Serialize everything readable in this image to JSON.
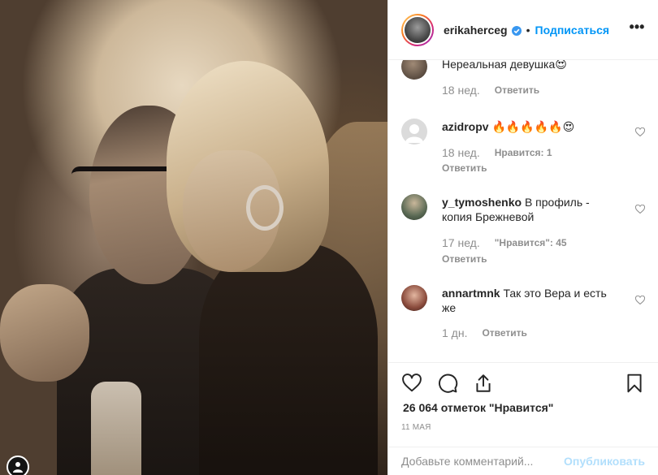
{
  "post": {
    "author": "erikaherceg",
    "separator": "•",
    "follow_label": "Подписаться",
    "more_label": "•••",
    "likes_text": "26 064 отметок \"Нравится\"",
    "date": "11 МАЯ"
  },
  "comments": [
    {
      "username": "",
      "text": "Нереальная девушка😍",
      "time": "18 нед.",
      "likes": "",
      "reply": "Ответить"
    },
    {
      "username": "azidropv",
      "text": "🔥🔥🔥🔥🔥😍",
      "time": "18 нед.",
      "likes": "Нравится: 1",
      "reply": "Ответить"
    },
    {
      "username": "y_tymoshenko",
      "text": "В профиль - копия Брежневой",
      "time": "17 нед.",
      "likes": "\"Нравится\": 45",
      "reply": "Ответить"
    },
    {
      "username": "annartmnk",
      "text": "Так это Вера и есть же",
      "time": "1 дн.",
      "likes": "",
      "reply": "Ответить"
    }
  ],
  "composer": {
    "placeholder": "Добавьте комментарий...",
    "publish_label": "Опубликовать"
  },
  "colors": {
    "link": "#0095f6",
    "publish_disabled": "#b2dffc",
    "meta": "#8e8e8e"
  },
  "icons": [
    "heart-icon",
    "comment-icon",
    "share-icon",
    "bookmark-icon",
    "verified-badge-icon",
    "more-icon"
  ]
}
